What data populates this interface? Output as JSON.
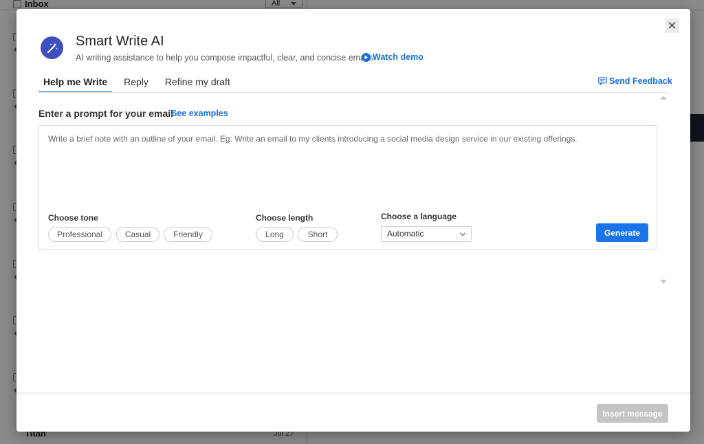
{
  "background": {
    "folder_label": "Inbox",
    "filter_value": "All",
    "last_sender": "Titan",
    "last_date": "Jul 27"
  },
  "modal": {
    "title": "Smart Write AI",
    "subtitle": "AI writing assistance to help you compose impactful, clear, and concise emails",
    "watch_demo": "Watch demo",
    "send_feedback": "Send Feedback",
    "close_symbol": "✕",
    "tabs": [
      {
        "label": "Help me Write",
        "active": true
      },
      {
        "label": "Reply",
        "active": false
      },
      {
        "label": "Refine my draft",
        "active": false
      }
    ],
    "prompt": {
      "label": "Enter a prompt for your email",
      "examples_link": "See examples",
      "placeholder": "Write a brief note with an outline of your email. Eg: Write an email to my clients introducing a social media design service in our existing offerings.",
      "value": ""
    },
    "tone": {
      "label": "Choose tone",
      "options": [
        "Professional",
        "Casual",
        "Friendly"
      ]
    },
    "length": {
      "label": "Choose length",
      "options": [
        "Long",
        "Short"
      ]
    },
    "language": {
      "label": "Choose a language",
      "selected": "Automatic"
    },
    "generate_label": "Generate",
    "insert_label": "Insert message"
  },
  "icons": {
    "logo": "magic-wand-icon",
    "demo": "play-circle-icon",
    "feedback": "message-icon"
  },
  "colors": {
    "accent": "#1a73e8",
    "link": "#1a6fd6",
    "logo_bg": "#3e4fbf",
    "disabled": "#c4c4c4"
  }
}
